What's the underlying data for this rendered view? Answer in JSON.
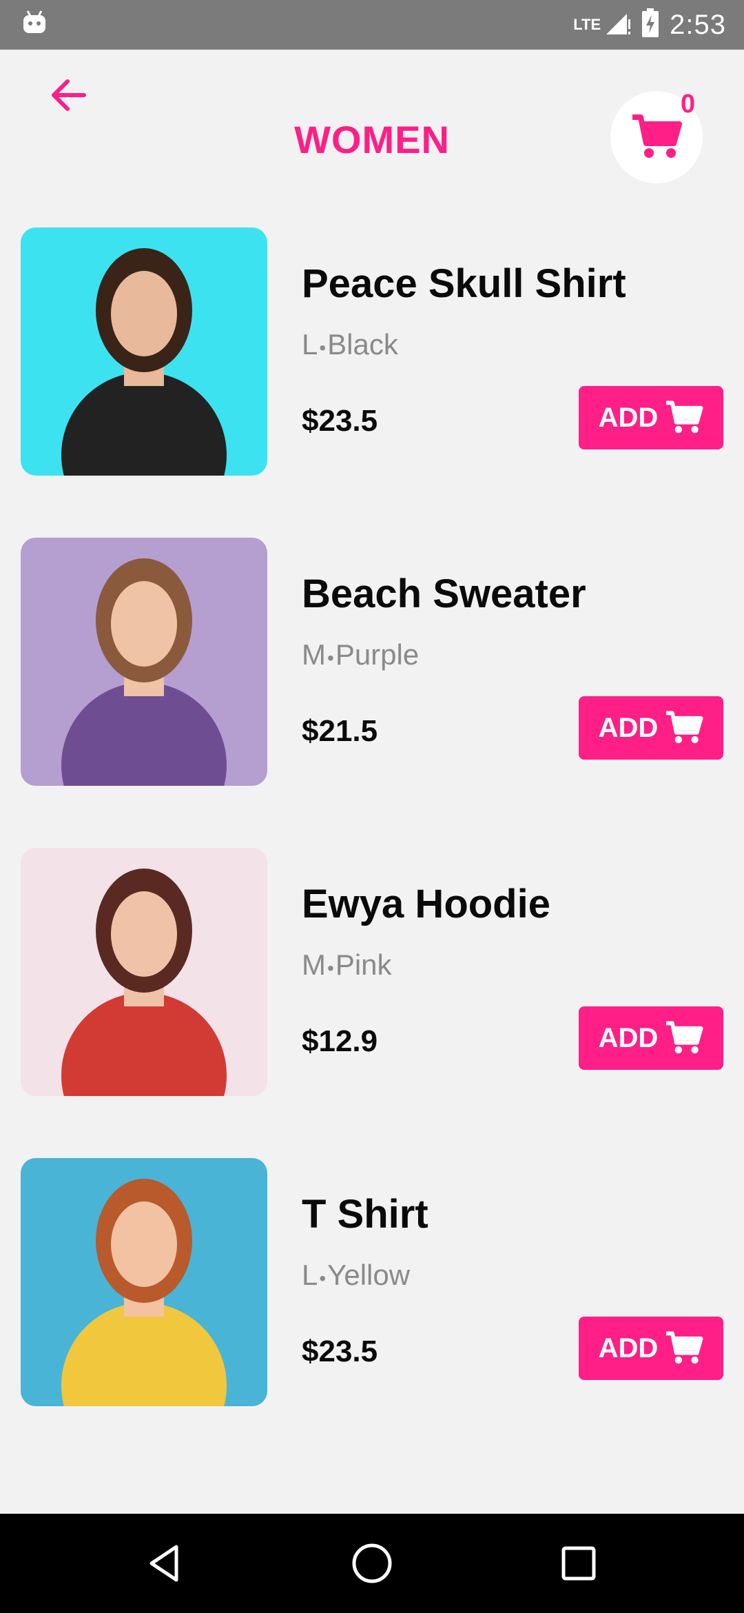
{
  "status": {
    "time": "2:53",
    "network": "LTE"
  },
  "header": {
    "title": "WOMEN",
    "cart_count": "0"
  },
  "theme": {
    "accent": "#ff1f86"
  },
  "products": [
    {
      "name": "Peace Skull Shirt",
      "size": "L",
      "color": "Black",
      "price": "$23.5",
      "add_label": "ADD",
      "bg": "#3de2f0",
      "figure": "#222222",
      "hair": "#3a2418",
      "skin": "#e8b99a"
    },
    {
      "name": "Beach Sweater",
      "size": "M",
      "color": "Purple",
      "price": "$21.5",
      "add_label": "ADD",
      "bg": "#b59ed0",
      "figure": "#6f4d92",
      "hair": "#8b5a3c",
      "skin": "#eec3a6"
    },
    {
      "name": "Ewya Hoodie",
      "size": "M",
      "color": "Pink",
      "price": "$12.9",
      "add_label": "ADD",
      "bg": "#f3e2e8",
      "figure": "#d23a34",
      "hair": "#5a2a22",
      "skin": "#f0c3a8"
    },
    {
      "name": "T Shirt",
      "size": "L",
      "color": "Yellow",
      "price": "$23.5",
      "add_label": "ADD",
      "bg": "#49b4d6",
      "figure": "#f1c73e",
      "hair": "#b85a2b",
      "skin": "#f2c2a2"
    }
  ]
}
